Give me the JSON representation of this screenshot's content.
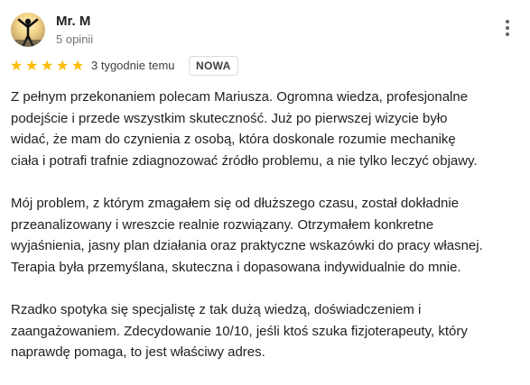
{
  "review": {
    "author": {
      "name": "Mr. M",
      "meta": "5 opinii",
      "avatar_icon": "person-silhouette-avatar"
    },
    "rating": 5,
    "rating_max": 5,
    "star_color": "#fbbc04",
    "time": "3 tygodnie temu",
    "badge": "NOWA",
    "menu_icon": "more-vert-icon",
    "paragraphs": [
      [
        "Z pełnym przekonaniem polecam Mariusza. Ogromna wiedza, profesjonalne",
        "podejście i przede wszystkim skuteczność. Już po pierwszej wizycie było",
        "widać, że mam do czynienia z osobą, która doskonale rozumie mechanikę",
        "ciała i potrafi trafnie zdiagnozować źródło problemu, a nie tylko leczyć objawy."
      ],
      [
        "Mój problem, z którym zmagałem się od dłuższego czasu, został dokładnie",
        "przeanalizowany i wreszcie realnie rozwiązany. Otrzymałem konkretne",
        "wyjaśnienia, jasny plan działania oraz praktyczne wskazówki do pracy własnej.",
        "Terapia była przemyślana, skuteczna i dopasowana indywidualnie do mnie."
      ],
      [
        "Rzadko spotyka się specjalistę z tak dużą wiedzą, doświadczeniem i",
        "zaangażowaniem. Zdecydowanie 10/10, jeśli ktoś szuka fizjoterapeuty, który",
        "naprawdę pomaga, to jest właściwy adres."
      ]
    ]
  }
}
